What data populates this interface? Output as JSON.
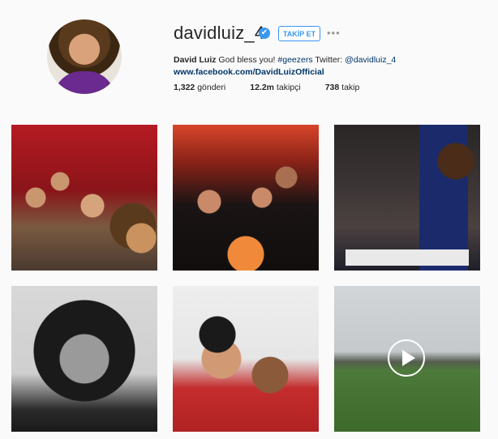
{
  "profile": {
    "username": "davidluiz_4",
    "verified_icon": "✔",
    "follow_label": "TAKİP ET",
    "more_label": "•••",
    "bio_name": "David Luiz",
    "bio_text_1": " God bless you! ",
    "bio_hashtag": "#geezers",
    "bio_text_2": " Twitter: ",
    "bio_handle": "@davidluiz_4",
    "website": "www.facebook.com/DavidLuizOfficial",
    "stats": {
      "posts_count": "1,322",
      "posts_label": " gönderi",
      "followers_count": "12.2m",
      "followers_label": " takipçi",
      "following_count": "738",
      "following_label": " takip"
    }
  },
  "posts": [
    {
      "id": "post-1",
      "kind": "photo"
    },
    {
      "id": "post-2",
      "kind": "photo"
    },
    {
      "id": "post-3",
      "kind": "photo"
    },
    {
      "id": "post-4",
      "kind": "photo"
    },
    {
      "id": "post-5",
      "kind": "photo"
    },
    {
      "id": "post-6",
      "kind": "video",
      "icon": "play-icon"
    }
  ],
  "colors": {
    "accent": "#3897f0",
    "link": "#003569",
    "text": "#262626",
    "background": "#fafafa"
  }
}
